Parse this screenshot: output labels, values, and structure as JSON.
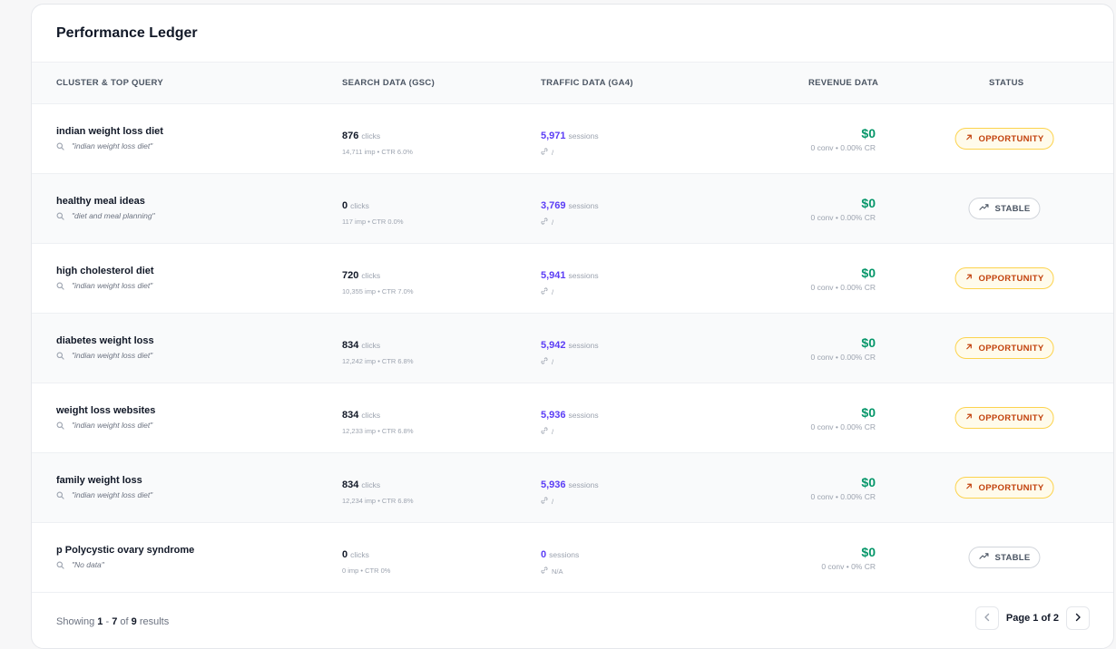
{
  "title": "Performance Ledger",
  "columns": {
    "cluster": "CLUSTER & TOP QUERY",
    "search": "SEARCH DATA (GSC)",
    "traffic": "TRAFFIC DATA (GA4)",
    "revenue": "REVENUE DATA",
    "status": "STATUS"
  },
  "units": {
    "clicks": "clicks",
    "sessions": "sessions"
  },
  "colors": {
    "accent": "#5b3df5",
    "revenue": "#059669",
    "opportunity": "#c2410c",
    "stable": "#4b5563"
  },
  "rows": [
    {
      "name": "indian weight loss diet",
      "query": "\"indian weight loss diet\"",
      "clicks": "876",
      "gsc_sub": "14,711 imp • CTR 6.0%",
      "sessions": "5,971",
      "link": "/",
      "revenue": "$0",
      "rev_sub": "0 conv • 0.00% CR",
      "status": "OPPORTUNITY",
      "status_type": "opportunity"
    },
    {
      "name": "healthy meal ideas",
      "query": "\"diet and meal planning\"",
      "clicks": "0",
      "gsc_sub": "117 imp • CTR 0.0%",
      "sessions": "3,769",
      "link": "/",
      "revenue": "$0",
      "rev_sub": "0 conv • 0.00% CR",
      "status": "STABLE",
      "status_type": "stable"
    },
    {
      "name": "high cholesterol diet",
      "query": "\"indian weight loss diet\"",
      "clicks": "720",
      "gsc_sub": "10,355 imp • CTR 7.0%",
      "sessions": "5,941",
      "link": "/",
      "revenue": "$0",
      "rev_sub": "0 conv • 0.00% CR",
      "status": "OPPORTUNITY",
      "status_type": "opportunity"
    },
    {
      "name": "diabetes weight loss",
      "query": "\"indian weight loss diet\"",
      "clicks": "834",
      "gsc_sub": "12,242 imp • CTR 6.8%",
      "sessions": "5,942",
      "link": "/",
      "revenue": "$0",
      "rev_sub": "0 conv • 0.00% CR",
      "status": "OPPORTUNITY",
      "status_type": "opportunity"
    },
    {
      "name": "weight loss websites",
      "query": "\"indian weight loss diet\"",
      "clicks": "834",
      "gsc_sub": "12,233 imp • CTR 6.8%",
      "sessions": "5,936",
      "link": "/",
      "revenue": "$0",
      "rev_sub": "0 conv • 0.00% CR",
      "status": "OPPORTUNITY",
      "status_type": "opportunity"
    },
    {
      "name": "family weight loss",
      "query": "\"indian weight loss diet\"",
      "clicks": "834",
      "gsc_sub": "12,234 imp • CTR 6.8%",
      "sessions": "5,936",
      "link": "/",
      "revenue": "$0",
      "rev_sub": "0 conv • 0.00% CR",
      "status": "OPPORTUNITY",
      "status_type": "opportunity"
    },
    {
      "name": "p Polycystic ovary syndrome",
      "query": "\"No data\"",
      "clicks": "0",
      "gsc_sub": "0 imp • CTR 0%",
      "sessions": "0",
      "link": "N/A",
      "revenue": "$0",
      "rev_sub": "0 conv • 0% CR",
      "status": "STABLE",
      "status_type": "stable"
    }
  ],
  "footer": {
    "showing_prefix": "Showing",
    "range_start": "1",
    "range_sep": "-",
    "range_end": "7",
    "of_word": "of",
    "total": "9",
    "results_word": "results",
    "page_label": "Page 1 of 2",
    "prev_icon": "chevron-left-icon",
    "next_icon": "chevron-right-icon"
  }
}
